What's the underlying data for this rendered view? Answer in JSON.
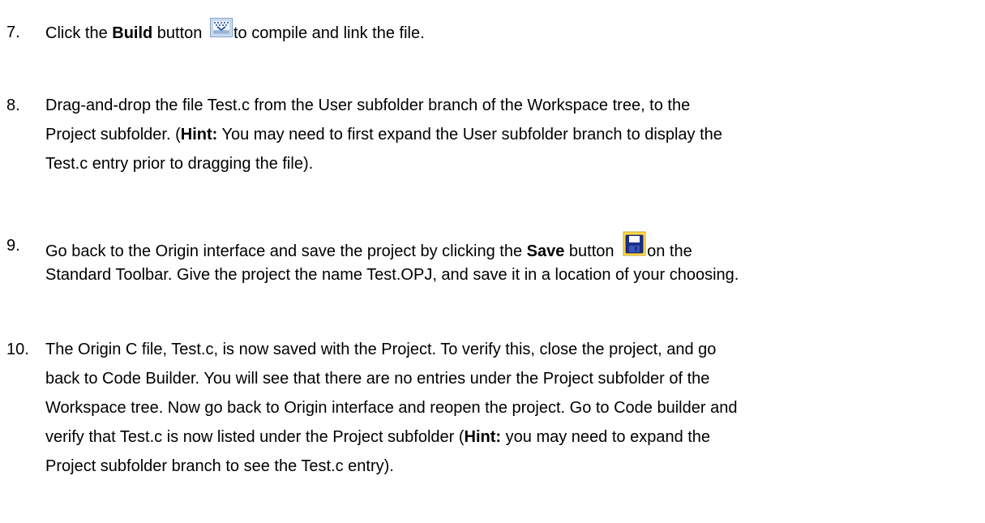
{
  "steps": [
    {
      "number": "7.",
      "line1": {
        "pre": "Click the ",
        "bold": "Build",
        "mid": " button ",
        "post": "to compile and link the file."
      },
      "icon": "build-icon"
    },
    {
      "number": "8.",
      "line1": "Drag-and-drop the file Test.c from the User subfolder branch of the Workspace tree, to the",
      "line2": {
        "pre": "Project subfolder. (",
        "bold": "Hint:",
        "post": " You may need to first expand the User subfolder branch to display the"
      },
      "line3": "Test.c entry prior to dragging the file)."
    },
    {
      "number": "9.",
      "line1": {
        "pre": "Go back to the Origin interface and save the project by clicking the ",
        "bold": "Save",
        "mid": " button ",
        "post": "on the"
      },
      "line2": "Standard Toolbar. Give the project the name Test.OPJ, and save it in a location of your choosing.",
      "icon": "floppy-disk-icon"
    },
    {
      "number": "10.",
      "line1": "The Origin C file, Test.c, is now saved with the Project. To verify this, close the project, and go",
      "line2": "back to Code Builder. You will see that there are no entries under the Project subfolder of the",
      "line3": "Workspace tree. Now go back to Origin interface and reopen the project. Go to Code builder and",
      "line4": {
        "pre": "verify that Test.c is now listed under the Project subfolder (",
        "bold": "Hint:",
        "post": " you may need to expand the"
      },
      "line5": "Project subfolder branch to see the Test.c entry)."
    }
  ]
}
